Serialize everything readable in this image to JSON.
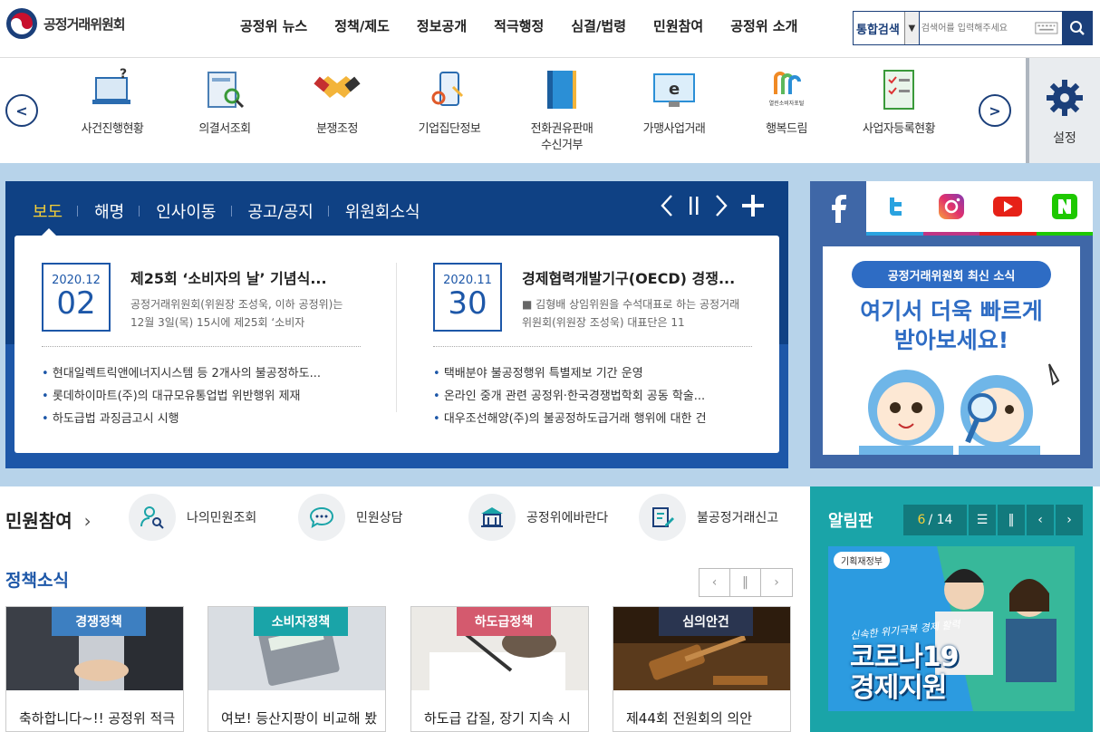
{
  "header": {
    "logo_text": "공정거래위원회",
    "nav": [
      "공정위 뉴스",
      "정책/제도",
      "정보공개",
      "적극행정",
      "심결/법령",
      "민원참여",
      "공정위 소개"
    ],
    "search": {
      "scope": "통합검색",
      "placeholder": "검색어를 입력해주세요"
    }
  },
  "quick": {
    "items": [
      {
        "label": "사건진행현황",
        "icon": "laptop-question-icon"
      },
      {
        "label": "의결서조회",
        "icon": "document-search-icon"
      },
      {
        "label": "분쟁조정",
        "icon": "handshake-icon"
      },
      {
        "label": "기업집단정보",
        "icon": "mobile-gear-icon"
      },
      {
        "label": "전화권유판매\n수신거부",
        "icon": "book-icon"
      },
      {
        "label": "가맹사업거래",
        "icon": "monitor-e-icon"
      },
      {
        "label": "행복드림",
        "icon": "happy-dream-logo-icon",
        "logo_text": "열린소비자포털"
      },
      {
        "label": "사업자등록현황",
        "icon": "checklist-icon"
      }
    ],
    "setting_label": "설정"
  },
  "news": {
    "tabs": [
      "보도",
      "해명",
      "인사이동",
      "공고/공지",
      "위원회소식"
    ],
    "active_tab": 0,
    "articles": [
      {
        "year_month": "2020.12",
        "day": "02",
        "title": "제25회 ‘소비자의 날’ 기념식...",
        "summary": "공정거래위원회(위원장 조성욱, 이하 공정위)는 12월 3일(목) 15시에 제25회 ‘소비자",
        "list": [
          "현대일렉트릭앤에너지시스템 등 2개사의 불공정하도...",
          "롯데하이마트(주)의 대규모유통업법 위반행위 제재",
          "하도급법 과징금고시 시행"
        ]
      },
      {
        "year_month": "2020.11",
        "day": "30",
        "title": "경제협력개발기구(OECD) 경쟁...",
        "summary": "■ 김형배 상임위원을 수석대표로 하는 공정거래위원회(위원장 조성욱) 대표단은 11",
        "list": [
          "택배분야 불공정행위 특별제보 기간 운영",
          "온라인 중개 관련 공정위·한국경쟁법학회 공동 학술...",
          "대우조선해양(주)의 불공정하도급거래 행위에 대한 건"
        ]
      }
    ]
  },
  "sns": {
    "tabs": [
      "facebook-icon",
      "twitter-icon",
      "instagram-icon",
      "youtube-icon",
      "naver-icon"
    ],
    "banner": {
      "pill": "공정거래위원회 최신 소식",
      "line1": "여기서 더욱 빠르게",
      "line2": "받아보세요!"
    }
  },
  "minwon": {
    "heading": "민원참여",
    "items": [
      {
        "label": "나의민원조회",
        "icon": "person-search-icon"
      },
      {
        "label": "민원상담",
        "icon": "chat-bubble-icon"
      },
      {
        "label": "공정위에바란다",
        "icon": "building-icon"
      },
      {
        "label": "불공정거래신고",
        "icon": "report-pen-icon"
      }
    ]
  },
  "policy": {
    "heading": "정책소식",
    "cards": [
      {
        "tag": "경쟁정책",
        "tag_color": "#3d7fc1",
        "text": "축하합니다~!! 공정위 적극행정 우수 공무원 선정"
      },
      {
        "tag": "소비자정책",
        "tag_color": "#1aa4a8",
        "text": "여보! 등산지팡이 비교해 봤는데 이건 어때"
      },
      {
        "tag": "하도급정책",
        "tag_color": "#d45a6e",
        "text": "하도급 갑질, 장기 지속 시 과징금 상향 조정"
      },
      {
        "tag": "심의안건",
        "tag_color": "#2a3550",
        "text": "제44회 전원회의 의안"
      }
    ]
  },
  "board": {
    "heading": "알림판",
    "current": "6",
    "total": "/ 14",
    "banner": {
      "ministry": "기획재정부",
      "line1": "코로나19",
      "line2": "경제지원",
      "slogan": "신속한 위기극복 경제 활력"
    }
  }
}
